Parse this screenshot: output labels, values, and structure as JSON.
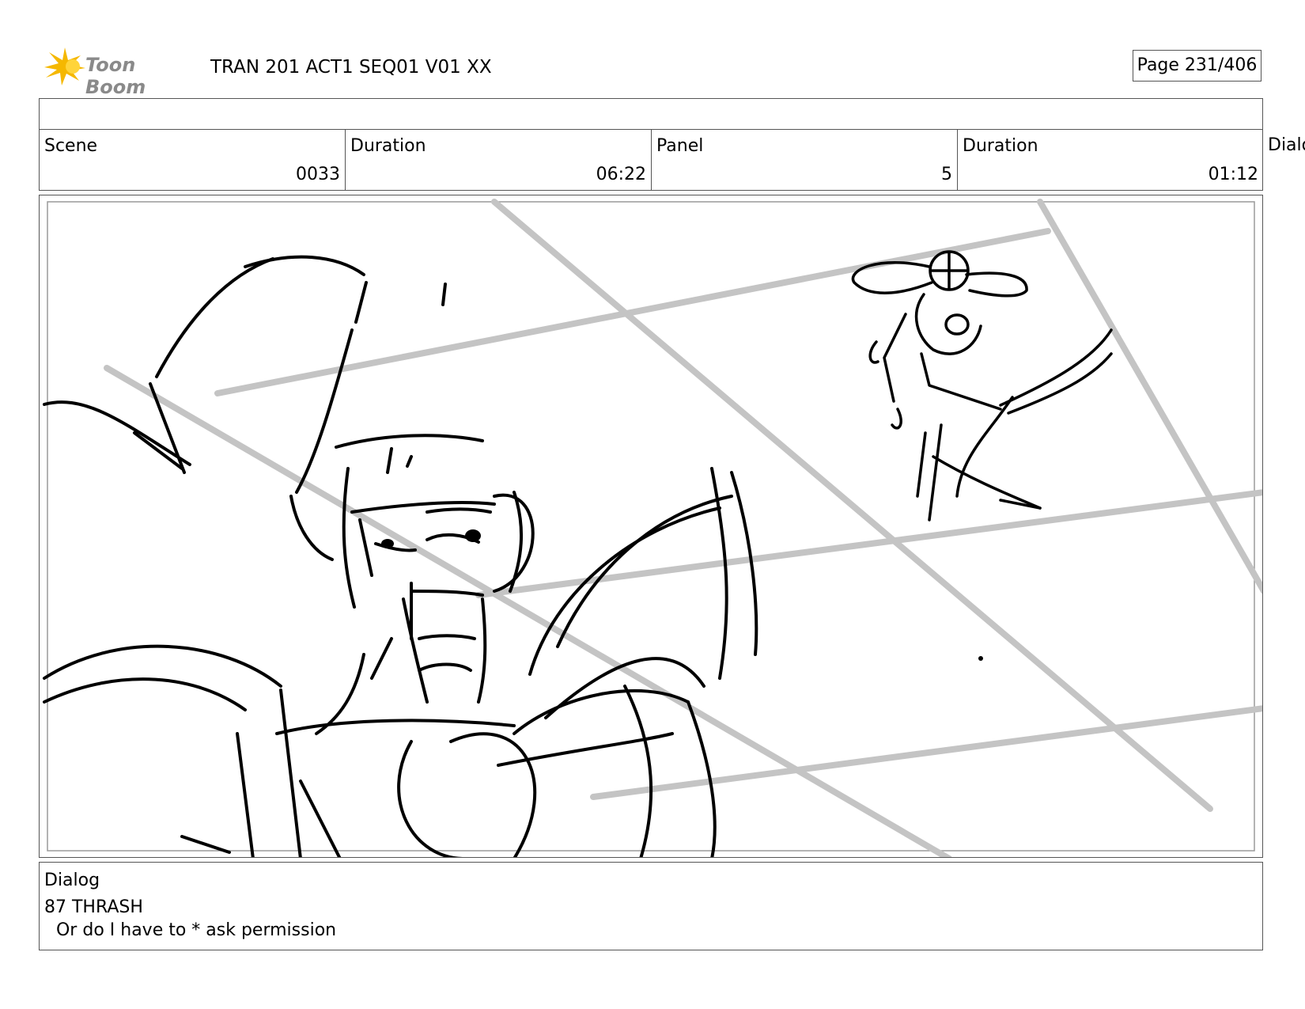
{
  "header": {
    "logo_text": "Toon Boom",
    "project_title": "TRAN 201 ACT1 SEQ01 V01 XX",
    "page_indicator": "Page 231/406"
  },
  "info": {
    "scene": {
      "label": "Scene",
      "value": "0033"
    },
    "scene_duration": {
      "label": "Duration",
      "value": "06:22"
    },
    "panel": {
      "label": "Panel",
      "value": "5"
    },
    "panel_duration": {
      "label": "Duration",
      "value": "01:12"
    },
    "overflow_label": "Dialog"
  },
  "panel_image": {
    "description_icon": "storyboard-sketch-image"
  },
  "dialog": {
    "label": "Dialog",
    "speaker": "87 THRASH",
    "line": " Or do I have to * ask permission"
  },
  "colors": {
    "border": "#555555",
    "logo_text": "#8a8a8a",
    "logo_star": "#f5b800",
    "sketch_line": "#000000",
    "guide_line": "#c4c4c4"
  }
}
